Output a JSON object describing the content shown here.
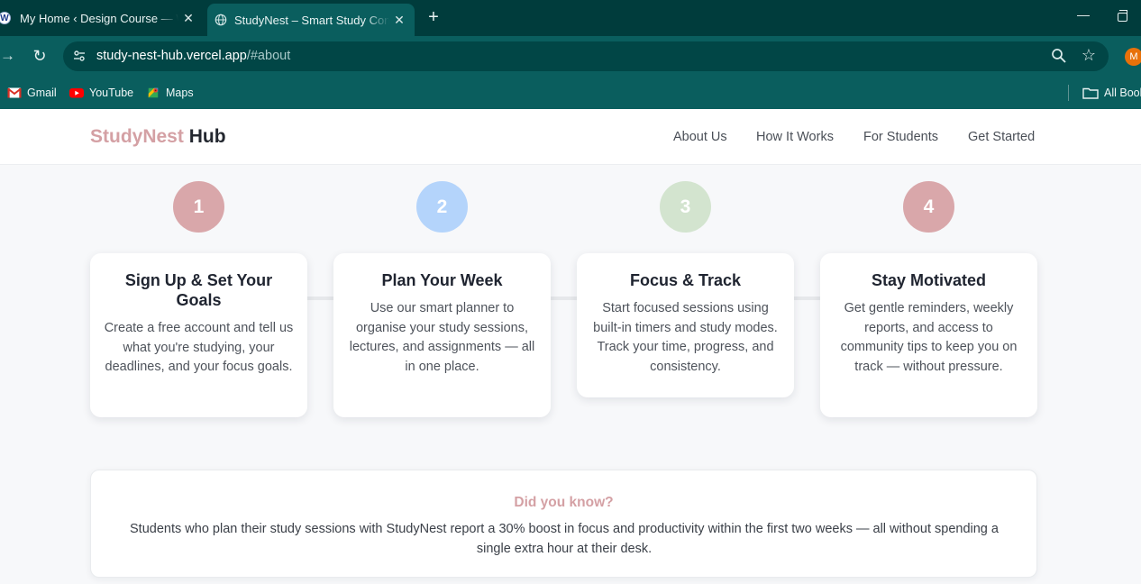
{
  "browser": {
    "tabs": [
      {
        "title": "My Home ‹ Design Course — WordPress",
        "icon": "wordpress-icon",
        "close": "✕"
      },
      {
        "title": "StudyNest – Smart Study Companion",
        "icon": "globe-icon",
        "close": "✕"
      }
    ],
    "new_tab": "+",
    "address": {
      "host": "study-nest-hub.vercel.app",
      "path": "/#about"
    },
    "profile_initial": "M",
    "bookmarks": [
      {
        "label": "Gmail",
        "icon": "gmail-icon"
      },
      {
        "label": "YouTube",
        "icon": "youtube-icon"
      },
      {
        "label": "Maps",
        "icon": "maps-icon"
      }
    ],
    "all_bookmarks": "All Bookmarks"
  },
  "header": {
    "brand_a": "StudyNest",
    "brand_b": "Hub",
    "nav": [
      "About Us",
      "How It Works",
      "For Students",
      "Get Started"
    ]
  },
  "steps": [
    {
      "number": "1",
      "title": "Sign Up & Set Your Goals",
      "text": "Create a free account and tell us what you're studying, your deadlines, and your focus goals.",
      "color": "#d9a7aa"
    },
    {
      "number": "2",
      "title": "Plan Your Week",
      "text": "Use our smart planner to organise your study sessions, lectures, and assignments — all in one place.",
      "color": "#b4d4fb"
    },
    {
      "number": "3",
      "title": "Focus & Track",
      "text": "Start focused sessions using built-in timers and study modes. Track your time, progress, and consistency.",
      "color": "#d3e4cf"
    },
    {
      "number": "4",
      "title": "Stay Motivated",
      "text": "Get gentle reminders, weekly reports, and access to community tips to keep you on track — without pressure.",
      "color": "#d9a7aa"
    }
  ],
  "fact": {
    "title": "Did you know?",
    "text": "Students who plan their study sessions with StudyNest report a 30% boost in focus and productivity within the first two weeks — all without spending a single extra hour at their desk."
  },
  "colors": {
    "brand_accent": "#d4a0a4",
    "chrome_dark": "#003c3c",
    "chrome": "#0a5e5e"
  }
}
